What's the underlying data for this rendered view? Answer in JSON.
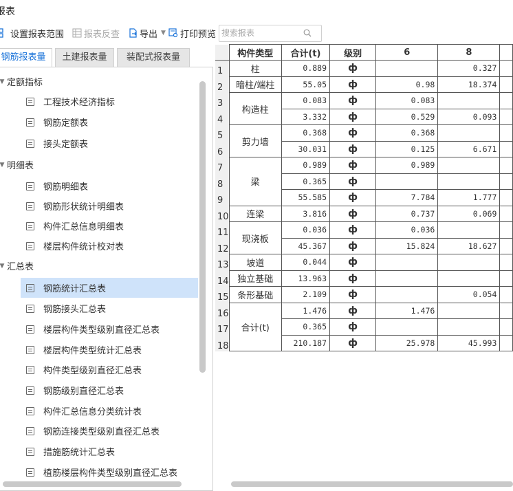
{
  "window": {
    "title": "报表"
  },
  "toolbar": {
    "set_range": "设置报表范围",
    "reverse_check": "报表反查",
    "export": "导出",
    "print_preview": "打印预览",
    "search_placeholder": "搜索报表"
  },
  "tabs": [
    "钢筋报表量",
    "土建报表量",
    "装配式报表量"
  ],
  "tree": {
    "groups": [
      {
        "label": "定额指标",
        "items": [
          "工程技术经济指标",
          "钢筋定额表",
          "接头定额表"
        ]
      },
      {
        "label": "明细表",
        "items": [
          "钢筋明细表",
          "钢筋形状统计明细表",
          "构件汇总信息明细表",
          "楼层构件统计校对表"
        ]
      },
      {
        "label": "汇总表",
        "items": [
          "钢筋统计汇总表",
          "钢筋接头汇总表",
          "楼层构件类型级别直径汇总表",
          "楼层构件类型统计汇总表",
          "构件类型级别直径汇总表",
          "钢筋级别直径汇总表",
          "构件汇总信息分类统计表",
          "钢筋连接类型级别直径汇总表",
          "措施筋统计汇总表",
          "植筋楼层构件类型级别直径汇总表"
        ]
      }
    ],
    "selected": "钢筋统计汇总表"
  },
  "table": {
    "headers": [
      "构件类型",
      "合计(t)",
      "级别",
      "6",
      "8"
    ],
    "row_numbers": [
      "1",
      "2",
      "3",
      "4",
      "5",
      "6",
      "7",
      "8",
      "9",
      "10",
      "11",
      "12",
      "13",
      "14",
      "15",
      "16",
      "17",
      "18"
    ],
    "types": [
      "柱",
      "暗柱/端柱",
      "构造柱",
      "剪力墙",
      "梁",
      "连梁",
      "现浇板",
      "坡道",
      "独立基础",
      "条形基础",
      "合计(t)"
    ],
    "rows": [
      {
        "total": "0.889",
        "grade": "ф",
        "d6": "",
        "d8": "0.327"
      },
      {
        "total": "55.05",
        "grade": "ф",
        "d6": "0.98",
        "d8": "18.374"
      },
      {
        "total": "0.083",
        "grade": "ф",
        "d6": "0.083",
        "d8": ""
      },
      {
        "total": "3.332",
        "grade": "ф",
        "d6": "0.529",
        "d8": "0.093"
      },
      {
        "total": "0.368",
        "grade": "ф",
        "d6": "0.368",
        "d8": ""
      },
      {
        "total": "30.031",
        "grade": "ф",
        "d6": "0.125",
        "d8": "6.671"
      },
      {
        "total": "0.989",
        "grade": "ф",
        "d6": "0.989",
        "d8": ""
      },
      {
        "total": "0.365",
        "grade": "ф",
        "d6": "",
        "d8": ""
      },
      {
        "total": "55.585",
        "grade": "ф",
        "d6": "7.784",
        "d8": "1.777"
      },
      {
        "total": "3.816",
        "grade": "ф",
        "d6": "0.737",
        "d8": "0.069"
      },
      {
        "total": "0.036",
        "grade": "ф",
        "d6": "0.036",
        "d8": ""
      },
      {
        "total": "45.367",
        "grade": "ф",
        "d6": "15.824",
        "d8": "18.627"
      },
      {
        "total": "0.044",
        "grade": "ф",
        "d6": "",
        "d8": ""
      },
      {
        "total": "13.963",
        "grade": "ф",
        "d6": "",
        "d8": ""
      },
      {
        "total": "2.109",
        "grade": "ф",
        "d6": "",
        "d8": "0.054"
      },
      {
        "total": "1.476",
        "grade": "ф",
        "d6": "1.476",
        "d8": ""
      },
      {
        "total": "0.365",
        "grade": "ф",
        "d6": "",
        "d8": ""
      },
      {
        "total": "210.187",
        "grade": "ф",
        "d6": "25.978",
        "d8": "45.993"
      }
    ]
  },
  "colors": {
    "accent": "#1a73d9",
    "selected_bg": "#cfe3fa"
  },
  "icons": [
    "settings-range-icon",
    "reverse-check-icon",
    "export-icon",
    "print-preview-icon",
    "search-icon",
    "document-icon"
  ]
}
